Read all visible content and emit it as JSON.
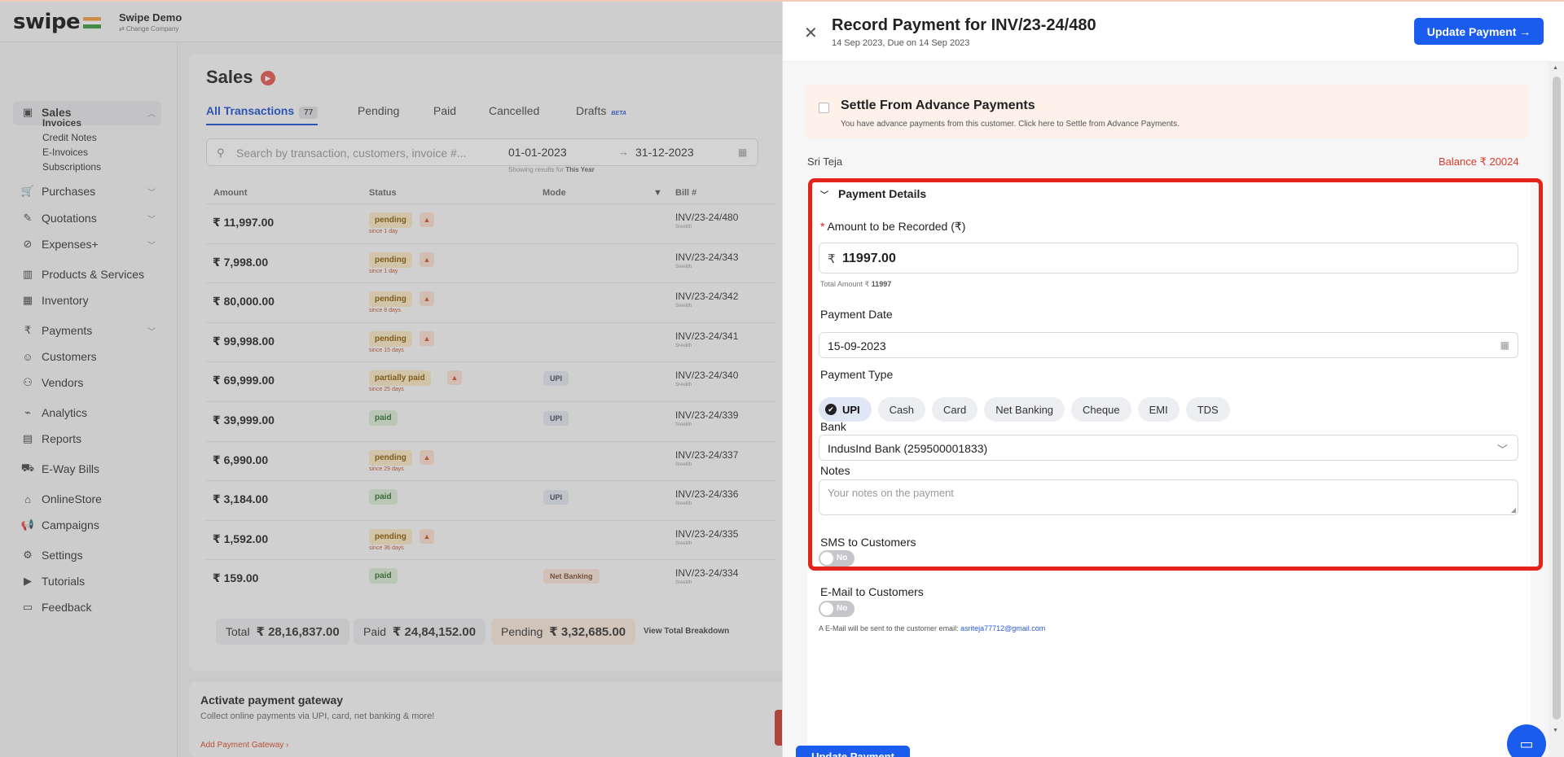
{
  "app": {
    "logo": "swipe",
    "company_name": "Swipe Demo",
    "company_sub": "⇄ Change Company"
  },
  "sidebar": {
    "sales": "Sales",
    "sales_sub": [
      "Invoices",
      "Credit Notes",
      "E-Invoices",
      "Subscriptions"
    ],
    "items": [
      "Purchases",
      "Quotations",
      "Expenses+",
      "Products & Services",
      "Inventory",
      "Payments",
      "Customers",
      "Vendors",
      "Analytics",
      "Reports",
      "E-Way Bills",
      "OnlineStore",
      "Campaigns",
      "Settings",
      "Tutorials",
      "Feedback"
    ]
  },
  "sales": {
    "title": "Sales",
    "tabs": [
      "All Transactions",
      "Pending",
      "Paid",
      "Cancelled",
      "Drafts"
    ],
    "all_count": "77",
    "beta": "BETA",
    "search_placeholder": "Search by transaction, customers, invoice #...",
    "date_from": "01-01-2023",
    "date_to": "31-12-2023",
    "showing_prefix": "Showing results for",
    "showing_value": "This Year",
    "columns": [
      "Amount",
      "Status",
      "Mode",
      "Bill #"
    ],
    "rows": [
      {
        "amount": "₹ 11,997.00",
        "status": "pending",
        "since": "since 1 day",
        "mode": "",
        "bill": "INV/23-24/480",
        "name": "Sreelith"
      },
      {
        "amount": "₹ 7,998.00",
        "status": "pending",
        "since": "since 1 day",
        "mode": "",
        "bill": "INV/23-24/343",
        "name": "Sreelith"
      },
      {
        "amount": "₹ 80,000.00",
        "status": "pending",
        "since": "since 8 days",
        "mode": "",
        "bill": "INV/23-24/342",
        "name": "Sreelith"
      },
      {
        "amount": "₹ 99,998.00",
        "status": "pending",
        "since": "since 15 days",
        "mode": "",
        "bill": "INV/23-24/341",
        "name": "Sreelith"
      },
      {
        "amount": "₹ 69,999.00",
        "status": "partially paid",
        "since": "since 25 days",
        "mode": "UPI",
        "bill": "INV/23-24/340",
        "name": "Sreelith"
      },
      {
        "amount": "₹ 39,999.00",
        "status": "paid",
        "since": "",
        "mode": "UPI",
        "bill": "INV/23-24/339",
        "name": "Sreelith"
      },
      {
        "amount": "₹ 6,990.00",
        "status": "pending",
        "since": "since 29 days",
        "mode": "",
        "bill": "INV/23-24/337",
        "name": "Sreelith"
      },
      {
        "amount": "₹ 3,184.00",
        "status": "paid",
        "since": "",
        "mode": "UPI",
        "bill": "INV/23-24/336",
        "name": "Sreelith"
      },
      {
        "amount": "₹ 1,592.00",
        "status": "pending",
        "since": "since 36 days",
        "mode": "",
        "bill": "INV/23-24/335",
        "name": "Sreelith"
      },
      {
        "amount": "₹ 159.00",
        "status": "paid",
        "since": "",
        "mode": "Net Banking",
        "bill": "INV/23-24/334",
        "name": "Sreelith"
      }
    ],
    "total_label": "Total",
    "total_value": "₹ 28,16,837.00",
    "paid_label": "Paid",
    "paid_value": "₹ 24,84,152.00",
    "pending_label": "Pending",
    "pending_value": "₹ 3,32,685.00",
    "view_breakdown": "View Total Breakdown",
    "gateway_title": "Activate payment gateway",
    "gateway_desc": "Collect online payments via UPI, card, net banking & more!",
    "gateway_link": "Add Payment Gateway ›"
  },
  "drawer": {
    "title": "Record Payment for INV/23-24/480",
    "subtitle": "14 Sep 2023, Due on 14 Sep 2023",
    "update_button": "Update Payment →",
    "settle_title": "Settle From Advance Payments",
    "settle_desc": "You have advance payments from this customer. Click here to Settle from Advance Payments.",
    "customer": "Sri Teja",
    "balance": "Balance  ₹ 20024",
    "section": "Payment Details",
    "amount_label": "Amount to be Recorded (₹)",
    "amount_value": "11997.00",
    "total_amount_prefix": "Total Amount ₹",
    "total_amount_value": "11997",
    "date_label": "Payment Date",
    "date_value": "15-09-2023",
    "type_label": "Payment Type",
    "types": [
      "UPI",
      "Cash",
      "Card",
      "Net Banking",
      "Cheque",
      "EMI",
      "TDS"
    ],
    "bank_label": "Bank",
    "bank_value": "IndusInd Bank (259500001833)",
    "notes_label": "Notes",
    "notes_placeholder": "Your notes on the payment",
    "sms_label": "SMS to Customers",
    "email_label": "E-Mail to Customers",
    "toggle_off": "No",
    "email_note_prefix": "A E-Mail will be sent to the customer email:",
    "email": "asriteja77712@gmail.com",
    "bottom_button": "Update Payment"
  }
}
